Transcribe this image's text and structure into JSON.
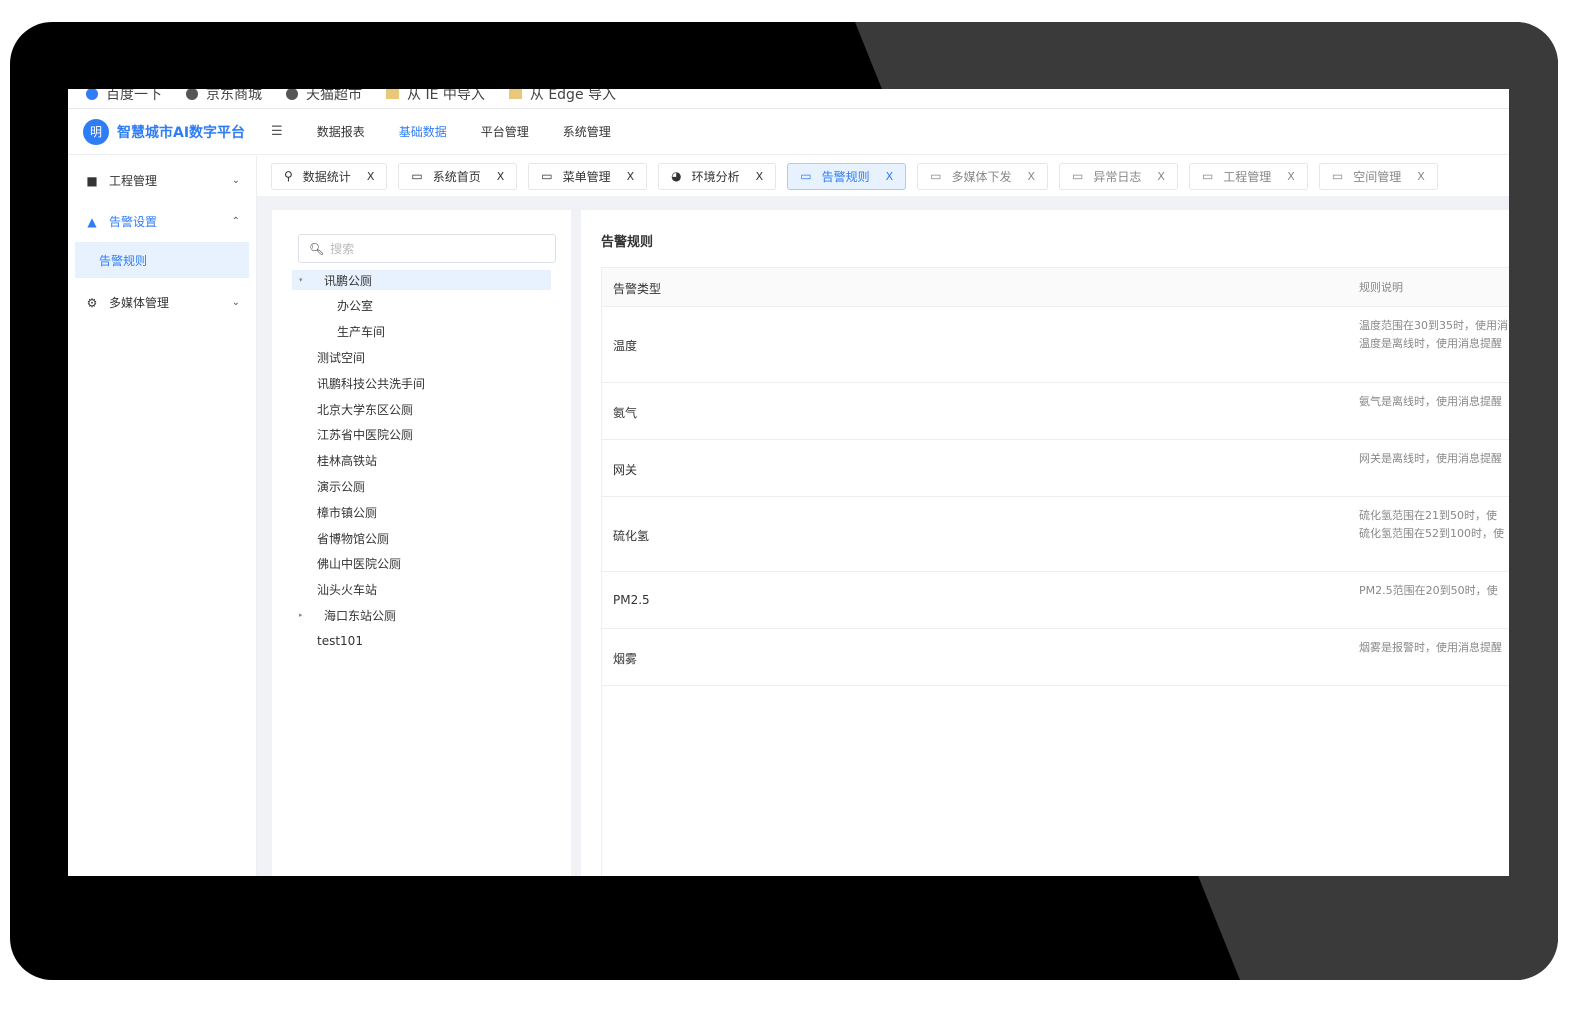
{
  "bookmarks": [
    "百度一下",
    "京东商城",
    "天猫超市",
    "从 IE 中导入",
    "从 Edge 导入"
  ],
  "header": {
    "brand": "智慧城市AI数字平台",
    "logo_text": "明",
    "nav": [
      "数据报表",
      "基础数据",
      "平台管理",
      "系统管理"
    ],
    "active_nav": "基础数据"
  },
  "sidebar": {
    "items": [
      {
        "label": "工程管理",
        "icon": "briefcase-icon"
      },
      {
        "label": "告警设置",
        "icon": "warning-icon",
        "open": true,
        "children": [
          "告警规则"
        ]
      },
      {
        "label": "多媒体管理",
        "icon": "gear-icon"
      }
    ]
  },
  "tabs": [
    {
      "label": "数据统计",
      "icon": "location-icon"
    },
    {
      "label": "系统首页",
      "icon": "window-icon"
    },
    {
      "label": "菜单管理",
      "icon": "window-icon"
    },
    {
      "label": "环境分析",
      "icon": "globe-icon"
    },
    {
      "label": "告警规则",
      "icon": "window-icon",
      "active": true
    },
    {
      "label": "多媒体下发",
      "icon": "window-icon"
    },
    {
      "label": "异常日志",
      "icon": "window-icon"
    },
    {
      "label": "工程管理",
      "icon": "window-icon"
    },
    {
      "label": "空间管理",
      "icon": "window-icon"
    }
  ],
  "tab_close": "X",
  "tree": {
    "search_placeholder": "搜索",
    "nodes": [
      "讯鹏公厕",
      "办公室",
      "生产车间",
      "测试空间",
      "讯鹏科技公共洗手间",
      "北京大学东区公厕",
      "江苏省中医院公厕",
      "桂林高铁站",
      "演示公厕",
      "樟市镇公厕",
      "省博物馆公厕",
      "佛山中医院公厕",
      "汕头火车站",
      "海口东站公厕",
      "test101"
    ]
  },
  "panel": {
    "title": "告警规则",
    "columns": [
      "告警类型",
      "规则说明"
    ],
    "rows": [
      {
        "type": "温度",
        "desc": [
          "温度范围在30到35时，使用消",
          "温度是离线时，使用消息提醒"
        ]
      },
      {
        "type": "氨气",
        "desc": [
          "氨气是离线时，使用消息提醒"
        ]
      },
      {
        "type": "网关",
        "desc": [
          "网关是离线时，使用消息提醒"
        ]
      },
      {
        "type": "硫化氢",
        "desc": [
          "硫化氢范围在21到50时，使",
          "硫化氢范围在52到100时，使"
        ]
      },
      {
        "type": "PM2.5",
        "desc": [
          "PM2.5范围在20到50时，使"
        ]
      },
      {
        "type": "烟雾",
        "desc": [
          "烟雾是报警时，使用消息提醒"
        ]
      }
    ]
  },
  "colors": {
    "accent": "#2f7df6",
    "frame": "#000000",
    "frame_highlight": "#3a3a3a"
  }
}
